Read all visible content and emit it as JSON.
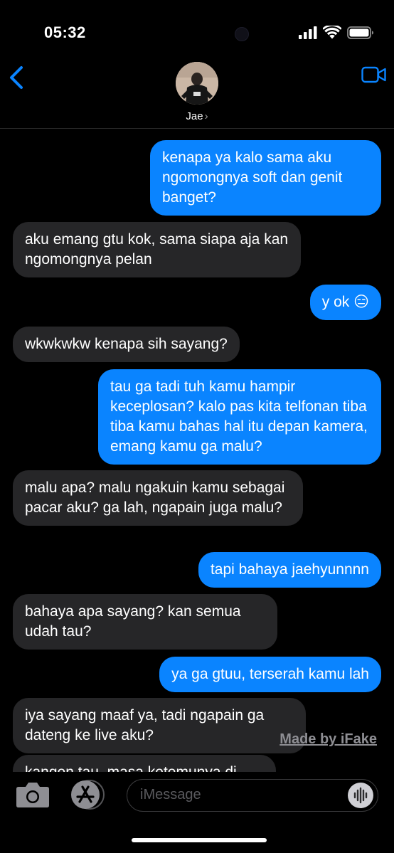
{
  "status_bar": {
    "time": "05:32"
  },
  "header": {
    "contact_name": "Jae",
    "chevron": "›",
    "back_icon": "chevron-left-icon",
    "video_icon": "video-camera-icon"
  },
  "colors": {
    "sent_bubble": "#0a84ff",
    "received_bubble": "#262628",
    "background": "#000000"
  },
  "messages": [
    {
      "type": "sent",
      "text": "kenapa ya kalo sama aku ngomongnya soft dan genit banget?"
    },
    {
      "type": "received",
      "text": "aku emang gtu kok, sama siapa aja kan ngomongnya pelan"
    },
    {
      "type": "sent",
      "text": "y ok 😑"
    },
    {
      "type": "received",
      "text": "wkwkwkw kenapa sih sayang?"
    },
    {
      "type": "sent",
      "text": "tau ga tadi tuh kamu hampir keceplosan? kalo pas kita telfonan tiba tiba kamu bahas hal itu depan kamera, emang kamu ga malu?"
    },
    {
      "type": "received",
      "text": "malu apa? malu ngakuin kamu sebagai pacar aku? ga lah, ngapain juga malu?"
    },
    {
      "type": "sent",
      "text": "tapi bahaya jaehyunnnn"
    },
    {
      "type": "received",
      "text": "bahaya apa sayang? kan semua udah tau?"
    },
    {
      "type": "sent",
      "text": "ya ga gtuu, terserah kamu lah"
    },
    {
      "type": "received",
      "text": "iya sayang maaf ya, tadi ngapain ga dateng ke live aku?"
    },
    {
      "type": "received",
      "text": "kangen tau, masa ketemunya di"
    }
  ],
  "watermark": "Made by iFake",
  "input_bar": {
    "placeholder": "iMessage",
    "camera_icon": "camera-icon",
    "appstore_icon": "app-store-icon",
    "audio_icon": "audio-waveform-icon"
  }
}
